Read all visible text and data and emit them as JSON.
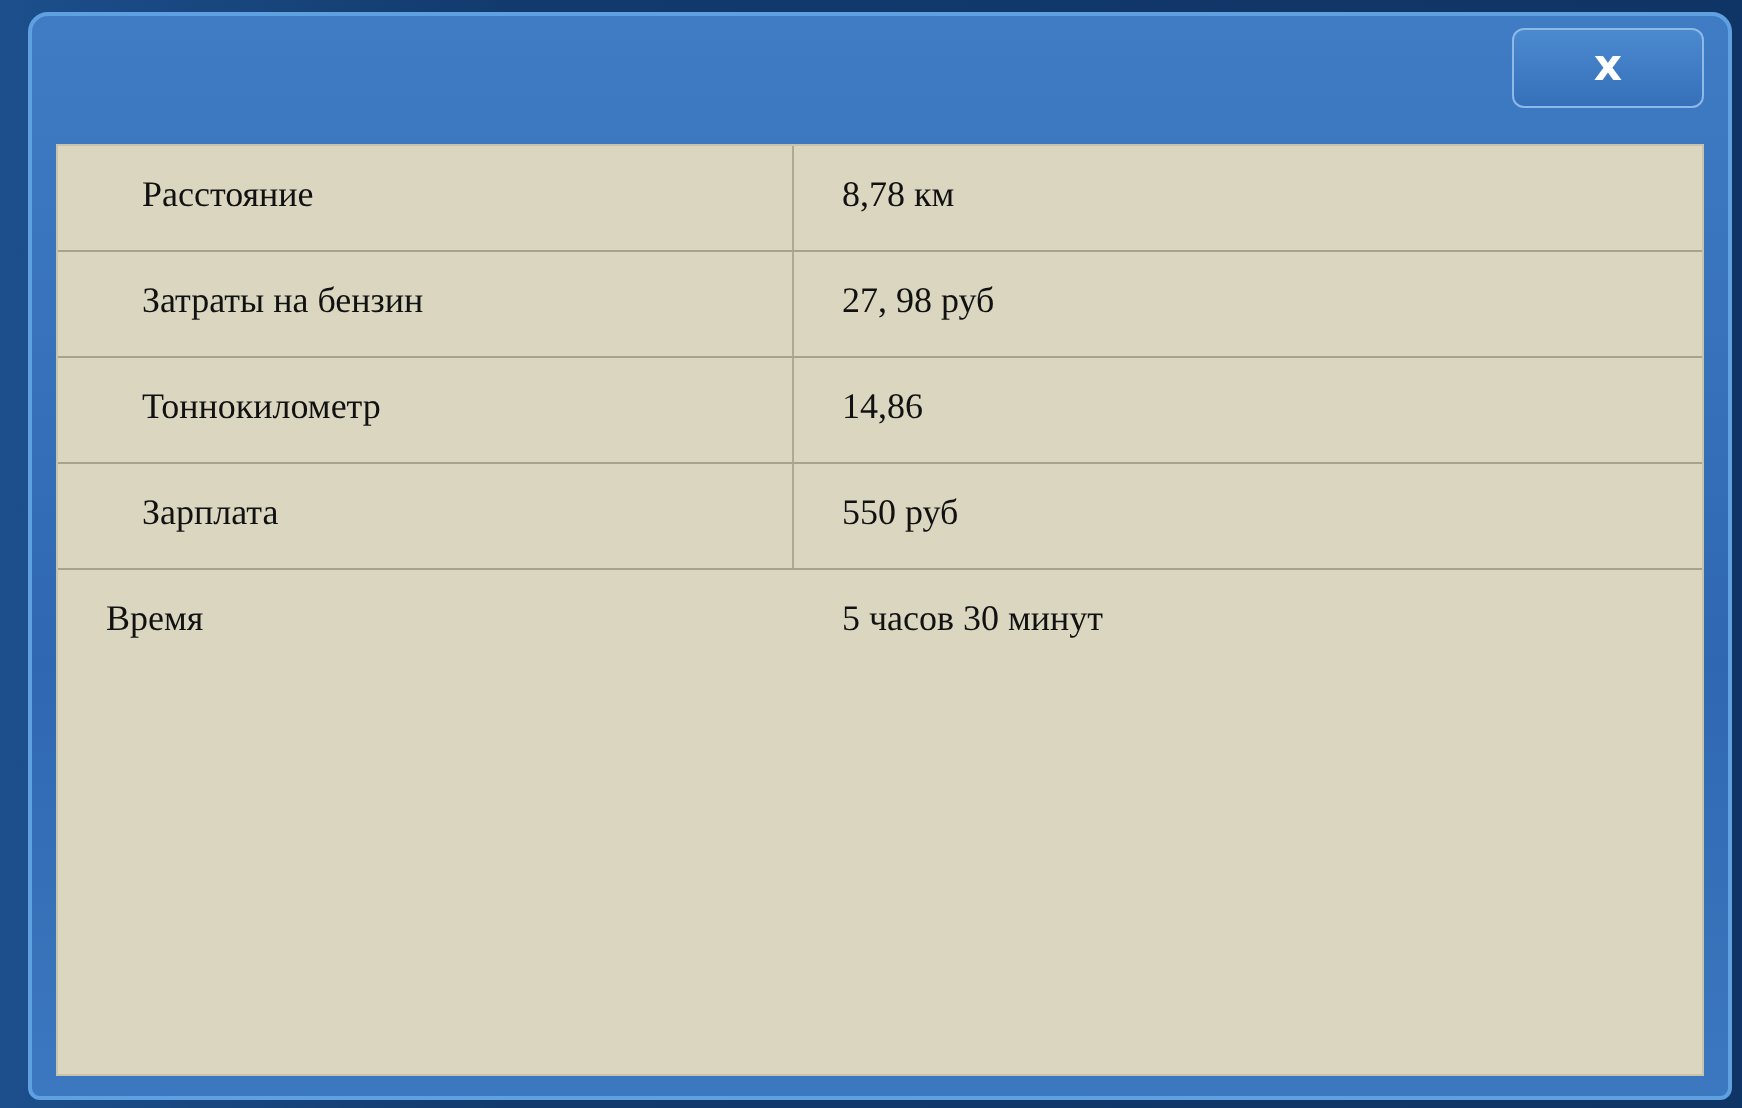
{
  "window": {
    "close_button": "x"
  },
  "rows": [
    {
      "label": "Расстояние",
      "value": "8,78 км"
    },
    {
      "label": "Затраты на бензин",
      "value": "27, 98 руб"
    },
    {
      "label": "Тоннокилометр",
      "value": "14,86"
    },
    {
      "label": "Зарплата",
      "value": "550 руб"
    },
    {
      "label": "Время",
      "value": "5 часов 30 минут"
    }
  ]
}
